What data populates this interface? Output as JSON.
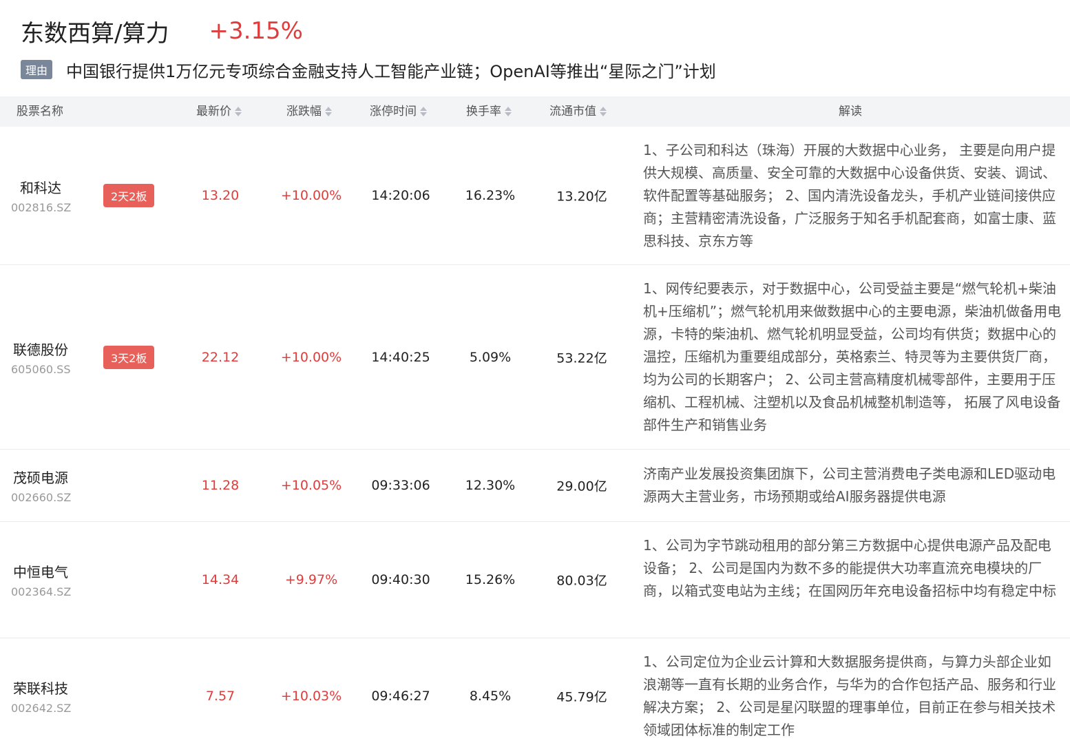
{
  "sector": {
    "name": "东数西算/算力",
    "change": "+3.15%"
  },
  "reason": {
    "tag": "理由",
    "text": "中国银行提供1万亿元专项综合金融支持人工智能产业链；OpenAI等推出“星际之门”计划"
  },
  "table": {
    "headers": {
      "name": "股票名称",
      "price": "最新价",
      "change": "涨跌幅",
      "limit_time": "涨停时间",
      "turnover": "换手率",
      "float_cap": "流通市值",
      "analysis": "解读"
    },
    "rows": [
      {
        "name": "和科达",
        "code": "002816.SZ",
        "badge": "2天2板",
        "price": "13.20",
        "change": "+10.00%",
        "limit_time": "14:20:06",
        "turnover": "16.23%",
        "float_cap": "13.20亿",
        "analysis": "1、子公司和科达（珠海）开展的大数据中心业务， 主要是向用户提供大规模、高质量、安全可靠的大数据中心设备供货、安装、调试、软件配置等基础服务； 2、国内清洗设备龙头，手机产业链间接供应商；主营精密清洗设备，广泛服务于知名手机配套商，如富士康、蓝思科技、京东方等"
      },
      {
        "name": "联德股份",
        "code": "605060.SS",
        "badge": "3天2板",
        "price": "22.12",
        "change": "+10.00%",
        "limit_time": "14:40:25",
        "turnover": "5.09%",
        "float_cap": "53.22亿",
        "analysis": "1、网传纪要表示，对于数据中心，公司受益主要是“燃气轮机+柴油机+压缩机”；燃气轮机用来做数据中心的主要电源，柴油机做备用电源，卡特的柴油机、燃气轮机明显受益，公司均有供货；数据中心的温控，压缩机为重要组成部分，英格索兰、特灵等为主要供货厂商，均为公司的长期客户； 2、公司主营高精度机械零部件，主要用于压缩机、工程机械、注塑机以及食品机械整机制造等， 拓展了风电设备部件生产和销售业务"
      },
      {
        "name": "茂硕电源",
        "code": "002660.SZ",
        "badge": "",
        "price": "11.28",
        "change": "+10.05%",
        "limit_time": "09:33:06",
        "turnover": "12.30%",
        "float_cap": "29.00亿",
        "analysis": "济南产业发展投资集团旗下，公司主营消费电子类电源和LED驱动电源两大主营业务，市场预期或给AI服务器提供电源"
      },
      {
        "name": "中恒电气",
        "code": "002364.SZ",
        "badge": "",
        "price": "14.34",
        "change": "+9.97%",
        "limit_time": "09:40:30",
        "turnover": "15.26%",
        "float_cap": "80.03亿",
        "analysis": "1、公司为字节跳动租用的部分第三方数据中心提供电源产品及配电设备； 2、公司是国内为数不多的能提供大功率直流充电模块的厂商，以箱式变电站为主线；在国网历年充电设备招标中均有稳定中标"
      },
      {
        "name": "荣联科技",
        "code": "002642.SZ",
        "badge": "",
        "price": "7.57",
        "change": "+10.03%",
        "limit_time": "09:46:27",
        "turnover": "8.45%",
        "float_cap": "45.79亿",
        "analysis": "1、公司定位为企业云计算和大数据服务提供商，与算力头部企业如浪潮等一直有长期的业务合作，与华为的合作包括产品、服务和行业解决方案； 2、公司是星闪联盟的理事单位，目前正在参与相关技术领域团体标准的制定工作"
      }
    ]
  }
}
